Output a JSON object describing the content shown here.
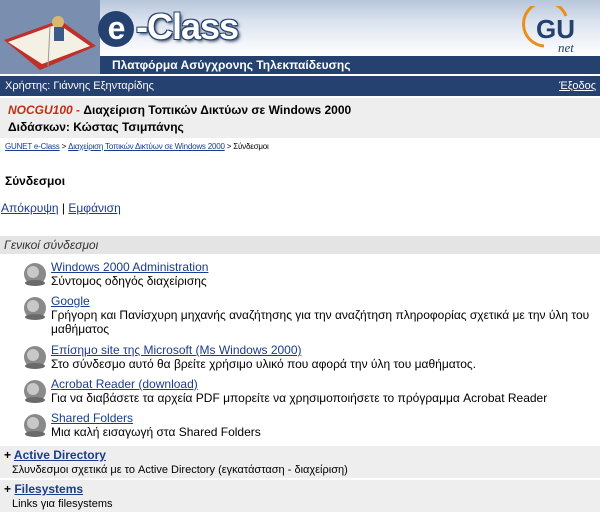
{
  "banner": {
    "logo": "-Class",
    "logo_e": "e",
    "subtitle": "Πλατφόρμα Ασύγχρονης Τηλεκπαίδευσης",
    "partner_logo": "gunet-logo",
    "partner_logo_text_main": "GU",
    "partner_logo_text_sub": "net"
  },
  "userbar": {
    "user": "Χρήστης: Γιάννης Εξηνταρίδης",
    "logout": "Έξοδος"
  },
  "course": {
    "code": "NOCGU100",
    "separator": " - ",
    "title": "Διαχείριση Τοπικών Δικτύων σε Windows 2000",
    "teacher": "Διδάσκων: Κώστας Τσιμπάνης"
  },
  "breadcrumb": {
    "home": "GUNET e-Class",
    "sep1": " > ",
    "course": "Διαχείριση Τοπικών Δικτύων σε Windows 2000",
    "sep2": " > ",
    "current": "Σύνδεσμοι"
  },
  "page_title": "Σύνδεσμοι",
  "toggles": {
    "hide": "Απόκρυψη",
    "divider": " | ",
    "show": "Εμφάνιση"
  },
  "general_category": "Γενικοί σύνδεσμοι",
  "links": [
    {
      "name": "Windows 2000 Administration",
      "desc": "Σύντομος οδηγός διαχείρισης",
      "icon": "globe-icon"
    },
    {
      "name": "Google",
      "desc": "Γρήγορη και Πανίσχυρη μηχανής αναζήτησης για την αναζήτηση πληροφορίας σχετικά με την ύλη του μαθήματος",
      "icon": "globe-icon"
    },
    {
      "name": "Επίσημο site της Microsoft (Ms Windows 2000)",
      "desc": "Στο σύνδεσμο αυτό θα βρείτε χρήσιμο υλικό που αφορά την ύλη του μαθήματος.",
      "icon": "globe-icon"
    },
    {
      "name": "Acrobat Reader (download)",
      "desc": "Για να διαβάσετε τα αρχεία PDF μπορείτε να χρησιμοποιήσετε το πρόγραμμα Acrobat Reader",
      "icon": "globe-icon"
    },
    {
      "name": "Shared Folders",
      "desc": "Μια καλή εισαγωγή στα Shared Folders",
      "icon": "globe-icon"
    }
  ],
  "categories": [
    {
      "marker": "+ ",
      "name": "Active Directory",
      "desc": "Σλυνδεσμοι σχετικά με το Active Directory (εγκατάσταση - διαχείριση)"
    },
    {
      "marker": "+ ",
      "name": "Filesystems",
      "desc": "Links για filesystems"
    }
  ],
  "colors": {
    "accent": "#24416f",
    "link": "#1a3c8c",
    "course_code": "#c03010"
  }
}
